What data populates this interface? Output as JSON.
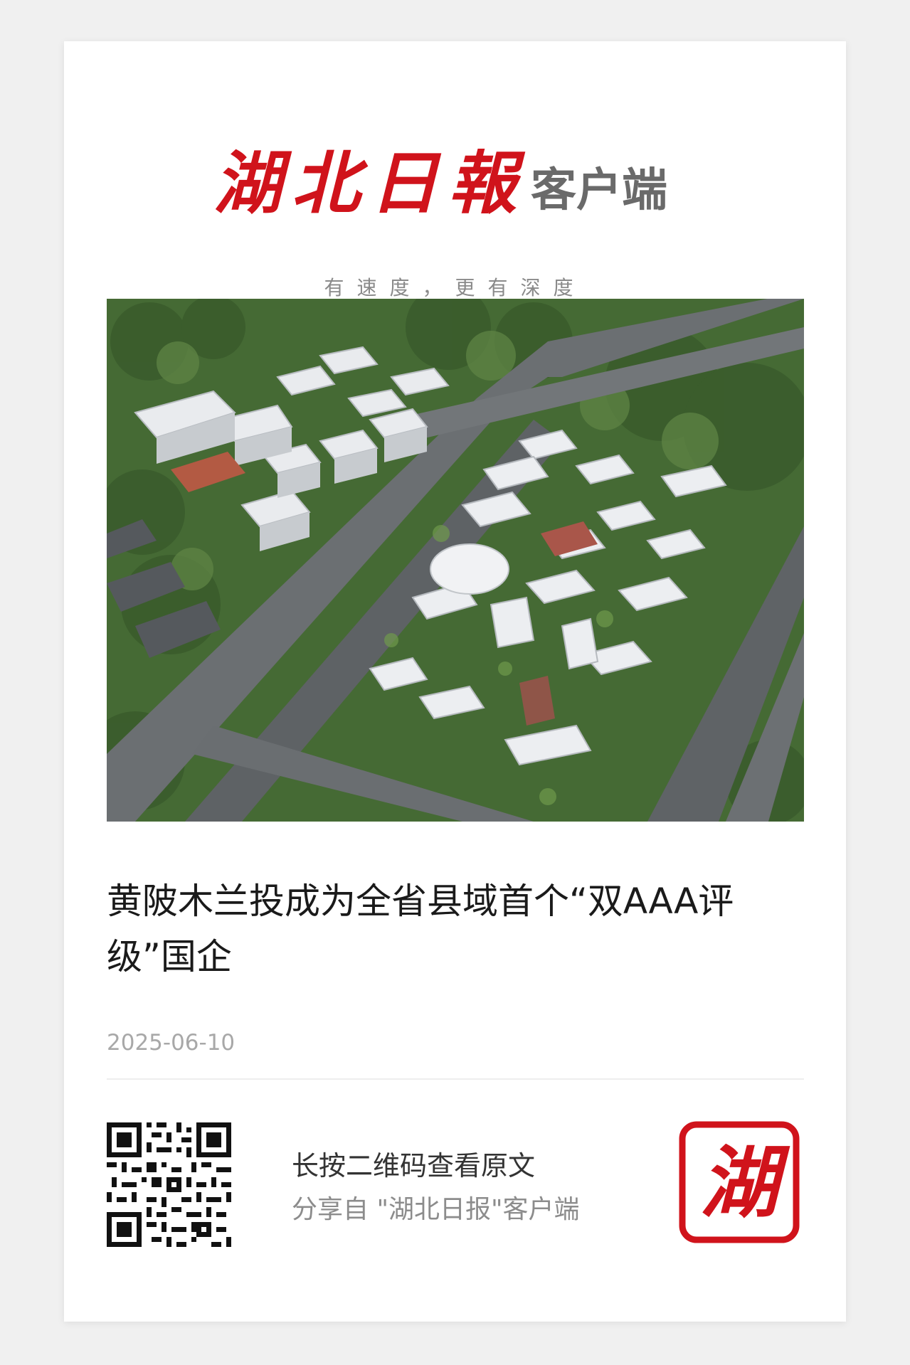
{
  "masthead": {
    "title_calligraphy": "湖北日報",
    "title_suffix": "客户端",
    "slogan": "有速度，更有深度"
  },
  "article": {
    "headline": "黄陂木兰投成为全省县域首个“双AAA评级”国企",
    "date": "2025-06-10",
    "hero_image": "aerial-industrial-park-rendering"
  },
  "share": {
    "cta": "长按二维码查看原文",
    "source": "分享自 \"湖北日报\"客户端",
    "seal_char": "湖"
  },
  "colors": {
    "brand_red": "#d0131b",
    "text_dark": "#1a1a1a",
    "text_muted": "#8c8c8c",
    "background": "#f0f0f0",
    "card": "#ffffff"
  },
  "icons": {
    "qr": "qr-code-icon",
    "seal": "seal-stamp-icon"
  }
}
